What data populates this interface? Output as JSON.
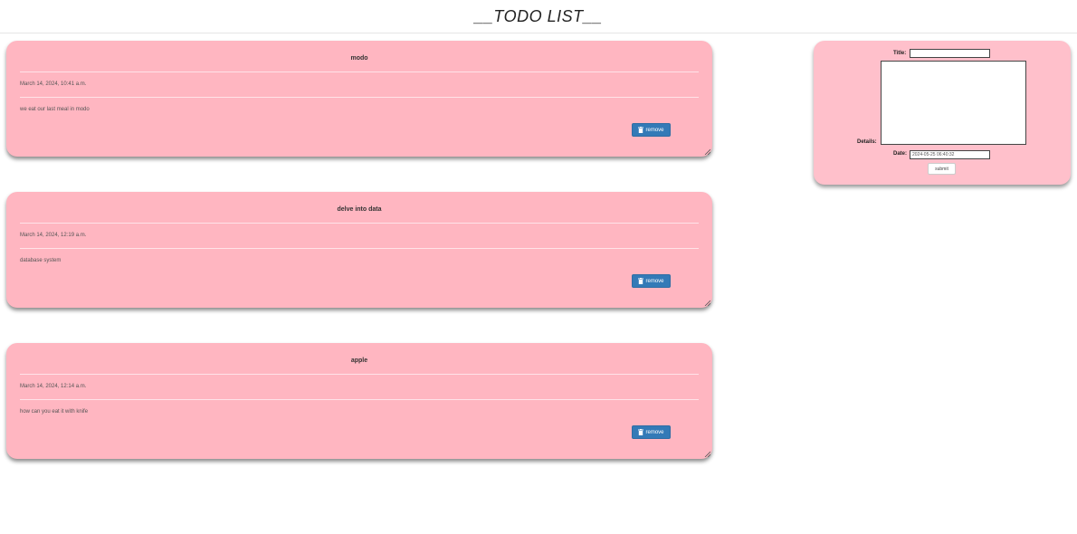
{
  "header": {
    "title": "__TODO LIST__"
  },
  "todos": [
    {
      "title": "modo",
      "date": "March 14, 2024, 10:41 a.m.",
      "details": "we eat our last meal in modo",
      "remove_label": "remove"
    },
    {
      "title": "delve into data",
      "date": "March 14, 2024, 12:19 a.m.",
      "details": "database system",
      "remove_label": "remove"
    },
    {
      "title": "apple",
      "date": "March 14, 2024, 12:14 a.m.",
      "details": "how can you eat it with knife",
      "remove_label": "remove"
    }
  ],
  "form": {
    "title_label": "Title:",
    "title_value": "",
    "details_label": "Details:",
    "details_value": "",
    "date_label": "Date:",
    "date_value": "2024-05-25 06:40:32",
    "submit_label": "submit"
  },
  "colors": {
    "card_background": "#ffb6c1",
    "form_background": "#ffc0cb",
    "button_primary": "#337ab7"
  }
}
